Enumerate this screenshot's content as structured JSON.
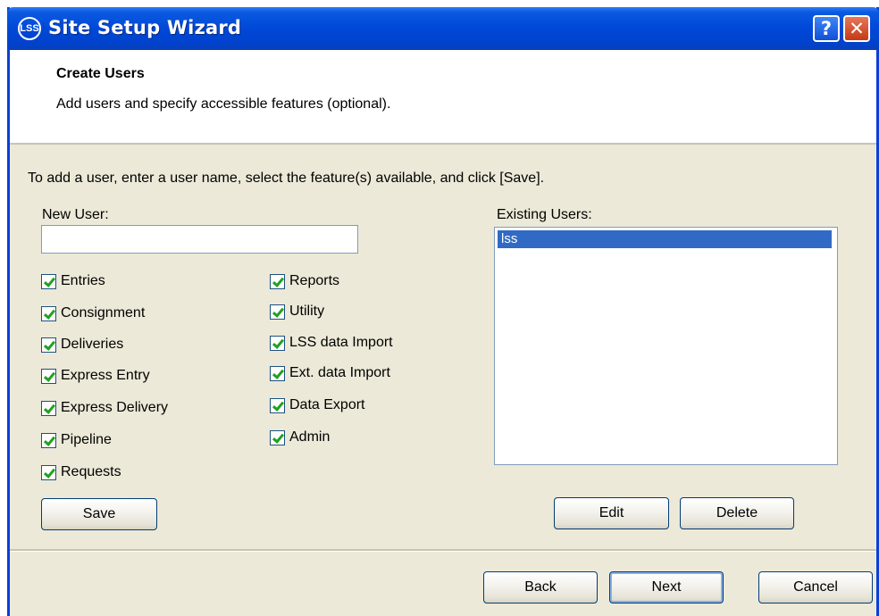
{
  "window": {
    "title": "Site Setup Wizard",
    "icon_text": "LSS"
  },
  "titlebar": {
    "help_label": "?",
    "close_label": "✕"
  },
  "header": {
    "title": "Create Users",
    "subtitle": "Add users and specify accessible features (optional)."
  },
  "body": {
    "instruction": "To add a user, enter a user name, select the feature(s) available, and click [Save].",
    "new_user_label": "New User:",
    "new_user_value": "",
    "existing_users_label": "Existing Users:",
    "existing_users": [
      "lss"
    ],
    "features_left": [
      {
        "label": "Entries",
        "checked": true
      },
      {
        "label": "Consignment",
        "checked": true
      },
      {
        "label": "Deliveries",
        "checked": true
      },
      {
        "label": "Express Entry",
        "checked": true
      },
      {
        "label": "Express Delivery",
        "checked": true
      },
      {
        "label": "Pipeline",
        "checked": true
      },
      {
        "label": "Requests",
        "checked": true
      }
    ],
    "features_right": [
      {
        "label": "Reports",
        "checked": true
      },
      {
        "label": "Utility",
        "checked": true
      },
      {
        "label": "LSS data Import",
        "checked": true
      },
      {
        "label": "Ext. data Import",
        "checked": true
      },
      {
        "label": "Data Export",
        "checked": true
      },
      {
        "label": "Admin",
        "checked": true
      }
    ],
    "save_label": "Save",
    "edit_label": "Edit",
    "delete_label": "Delete"
  },
  "footer": {
    "back_label": "Back",
    "next_label": "Next",
    "cancel_label": "Cancel"
  },
  "colors": {
    "titlebar": "#0048d8",
    "dialog_bg": "#ece9d8",
    "selection": "#316ac5",
    "check": "#21a121"
  }
}
